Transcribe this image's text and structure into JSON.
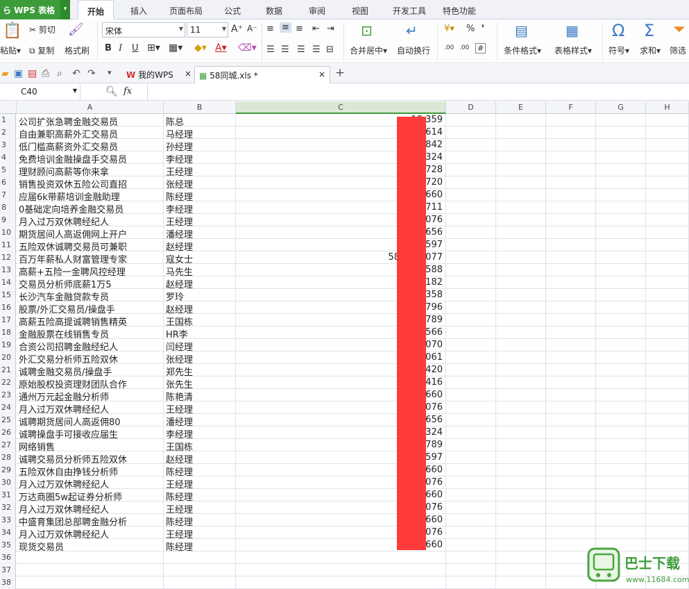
{
  "app": {
    "title": "WPS 表格",
    "arrow": "▾"
  },
  "menu": {
    "tabs": [
      "开始",
      "插入",
      "页面布局",
      "公式",
      "数据",
      "审阅",
      "视图",
      "开发工具",
      "特色功能"
    ]
  },
  "ribbon": {
    "paste": "粘贴",
    "paste_arrow": "▾",
    "cut": "剪切",
    "copy": "复制",
    "format_painter": "格式刷",
    "font_name": "宋体",
    "font_size": "11",
    "bold": "B",
    "italic": "I",
    "underline": "U",
    "merge": "合并居中",
    "merge_arrow": "▾",
    "wrap": "自动换行",
    "percent": "%",
    "comma": "❜",
    "cond_format": "条件格式",
    "cond_arrow": "▾",
    "table_style": "表格样式",
    "table_arrow": "▾",
    "symbol": "符号",
    "symbol_arrow": "▾",
    "sum": "求和",
    "sum_arrow": "▾",
    "filter": "筛选"
  },
  "doc_tabs": [
    {
      "label": "我的WPS",
      "close": "×"
    },
    {
      "label": "58同城.xls *",
      "close": "×"
    }
  ],
  "new_tab": "+",
  "formula_bar": {
    "cell_ref": "C40",
    "fx": "fx",
    "value": ""
  },
  "columns": [
    "A",
    "B",
    "C",
    "D",
    "E",
    "F",
    "G",
    "H"
  ],
  "rows": [
    {
      "n": "1",
      "a": "公司扩张急聘金融交易员",
      "b": "陈总",
      "c": "18  359"
    },
    {
      "n": "2",
      "a": "自由兼职高薪外汇交易员",
      "b": "马经理",
      "c": "15  0614"
    },
    {
      "n": "3",
      "a": "低门槛高薪资外汇交易员",
      "b": "孙经理",
      "c": "5842"
    },
    {
      "n": "4",
      "a": "免费培训金融操盘手交易员",
      "b": "李经理",
      "c": "15  0324"
    },
    {
      "n": "5",
      "a": "理财顾问高薪等你来拿",
      "b": "王经理",
      "c": "18  2728"
    },
    {
      "n": "6",
      "a": "销售投资双休五险公司直招",
      "b": "张经理",
      "c": "15  3720"
    },
    {
      "n": "7",
      "a": "应届6k带薪培训金融助理",
      "b": "陈经理",
      "c": "18  5660"
    },
    {
      "n": "8",
      "a": "0基础定向培养金融交易员",
      "b": "李经理",
      "c": "18  711"
    },
    {
      "n": "9",
      "a": "月入过万双休聘经纪人",
      "b": "王经理",
      "c": "13  0076"
    },
    {
      "n": "10",
      "a": "期货居间人高返佣网上开户",
      "b": "潘经理",
      "c": "18  3656"
    },
    {
      "n": "11",
      "a": "五险双休诚聘交易员可兼职",
      "b": "赵经理",
      "c": "13  5597"
    },
    {
      "n": "12",
      "a": "百万年薪私人财富管理专家",
      "b": "寇女士",
      "c": "58255  2077"
    },
    {
      "n": "13",
      "a": "高薪+五险一金聘风控经理",
      "b": "马先生",
      "c": "010-  7588"
    },
    {
      "n": "14",
      "a": "交易员分析师底薪1万5",
      "b": "赵经理",
      "c": "18  3182"
    },
    {
      "n": "15",
      "a": "长沙汽车金融贷款专员",
      "b": "罗玲",
      "c": "13  3358"
    },
    {
      "n": "16",
      "a": "股票/外汇交易员/操盘手",
      "b": "赵经理",
      "c": "15  5796"
    },
    {
      "n": "17",
      "a": "高薪五险高提诚聘销售精英",
      "b": "王国栋",
      "c": "18  5789"
    },
    {
      "n": "18",
      "a": "金融股票在线销售专员",
      "b": "HR李",
      "c": "010-  3566"
    },
    {
      "n": "19",
      "a": "合资公司招聘金融经纪人",
      "b": "闫经理",
      "c": "18  0070"
    },
    {
      "n": "20",
      "a": "外汇交易分析师五险双休",
      "b": "张经理",
      "c": "15  0061"
    },
    {
      "n": "21",
      "a": "诚聘金融交易员/操盘手",
      "b": "郑先生",
      "c": "15  0420"
    },
    {
      "n": "22",
      "a": "原始股权投资理财团队合作",
      "b": "张先生",
      "c": "18  2416"
    },
    {
      "n": "23",
      "a": "通州万元起金融分析师",
      "b": "陈艳清",
      "c": "18  5660"
    },
    {
      "n": "24",
      "a": "月入过万双休聘经纪人",
      "b": "王经理",
      "c": "13  0076"
    },
    {
      "n": "25",
      "a": "诚聘期货居间人高返佣80",
      "b": "潘经理",
      "c": "18  3656"
    },
    {
      "n": "26",
      "a": "诚聘操盘手可接收应届生",
      "b": "李经理",
      "c": "15  0324"
    },
    {
      "n": "27",
      "a": "网络销售",
      "b": "王国栋",
      "c": "18  5789"
    },
    {
      "n": "28",
      "a": "诚聘交易员分析师五险双休",
      "b": "赵经理",
      "c": "13  5597"
    },
    {
      "n": "29",
      "a": "五险双休自由挣钱分析师",
      "b": "陈经理",
      "c": "18  5660"
    },
    {
      "n": "30",
      "a": "月入过万双休聘经纪人",
      "b": "王经理",
      "c": "13  0076"
    },
    {
      "n": "31",
      "a": "万达商圈5w起证券分析师",
      "b": "陈经理",
      "c": "18  5660"
    },
    {
      "n": "32",
      "a": "月入过万双休聘经纪人",
      "b": "王经理",
      "c": "13  0076"
    },
    {
      "n": "33",
      "a": "中盛育集团总部聘金融分析",
      "b": "陈经理",
      "c": "18  5660"
    },
    {
      "n": "34",
      "a": "月入过万双休聘经纪人",
      "b": "王经理",
      "c": "13  0076"
    },
    {
      "n": "35",
      "a": "现货交易员",
      "b": "陈经理",
      "c": "18  5660"
    },
    {
      "n": "36",
      "a": "",
      "b": "",
      "c": ""
    },
    {
      "n": "37",
      "a": "",
      "b": "",
      "c": ""
    },
    {
      "n": "38",
      "a": "",
      "b": "",
      "c": ""
    }
  ],
  "watermark": {
    "title": "巴士下载",
    "url": "www.11684.com"
  },
  "colors": {
    "accent": "#3d9c3a",
    "redaction": "#ff3a3a"
  }
}
